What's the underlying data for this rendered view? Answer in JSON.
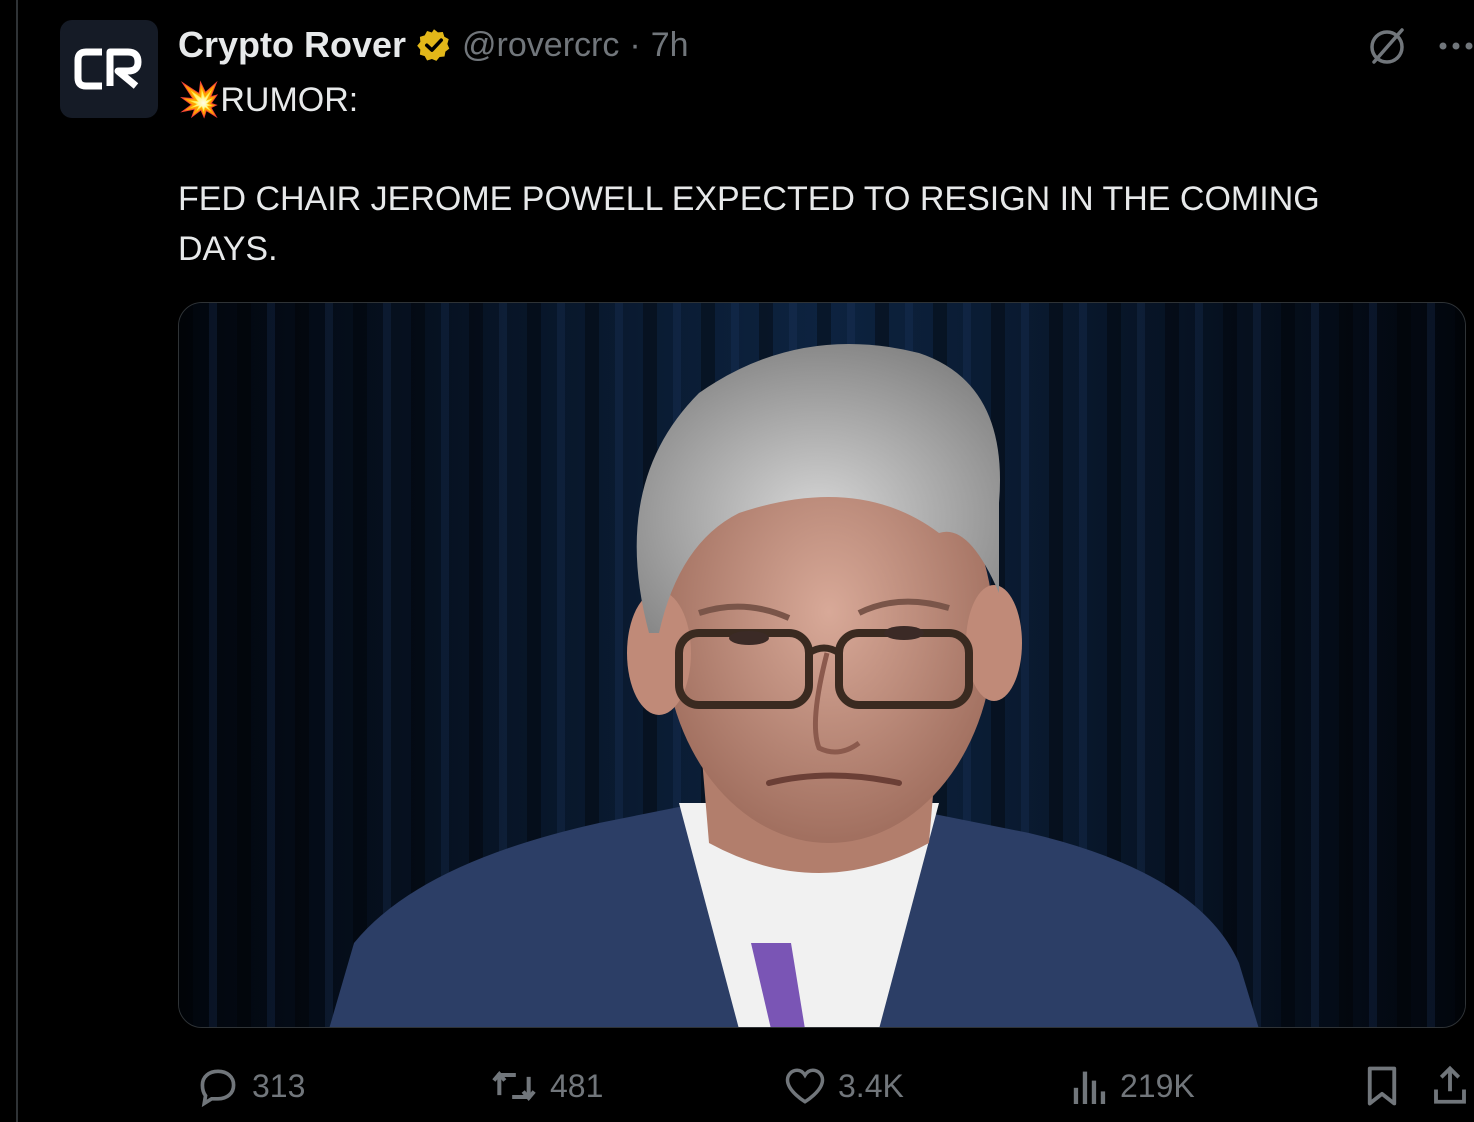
{
  "tweet": {
    "display_name": "Crypto Rover",
    "handle": "@rovercrc",
    "separator": "·",
    "time": "7h",
    "avatar_text": "CR",
    "line1": "💥RUMOR:",
    "line2": "FED CHAIR JEROME POWELL EXPECTED TO RESIGN IN THE COMING",
    "line3": "DAYS."
  },
  "actions": {
    "replies": "313",
    "reposts": "481",
    "likes": "3.4K",
    "views": "219K"
  },
  "colors": {
    "background": "#000000",
    "text": "#e7e9ea",
    "muted": "#71767b",
    "verified_badge": "#e2b719",
    "border": "#2f3336"
  },
  "icons": [
    "verified-badge-icon",
    "grok-icon",
    "more-icon",
    "reply-icon",
    "repost-icon",
    "like-icon",
    "views-icon",
    "bookmark-icon",
    "share-icon"
  ]
}
